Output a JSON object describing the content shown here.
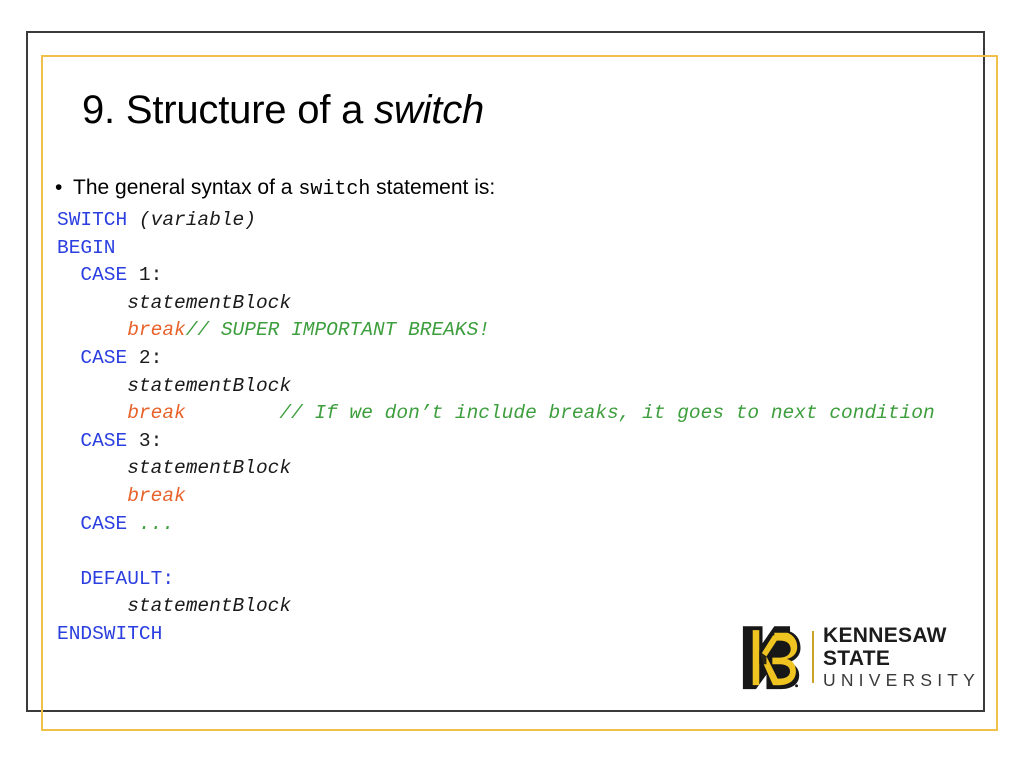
{
  "slide": {
    "title_prefix": "9. Structure of a ",
    "title_keyword": "switch",
    "bullet": {
      "marker": "•",
      "text_before": "The general syntax of a ",
      "keyword": "switch",
      "text_after": " statement is:"
    },
    "colors": {
      "keyword_blue": "#2b3fe0",
      "comment_green": "#3d9e3d",
      "break_orange": "#e8622a",
      "frame_gold": "#f0c04a",
      "frame_dark": "#3a3a3a",
      "logo_gold": "#f0c420",
      "text_black": "#1a1a1a"
    },
    "code_lines": [
      [
        {
          "t": "SWITCH",
          "c": "kw"
        },
        {
          "t": " ",
          "c": "plain"
        },
        {
          "t": "(variable)",
          "c": "var"
        }
      ],
      [
        {
          "t": "BEGIN",
          "c": "kw"
        }
      ],
      [
        {
          "t": "  ",
          "c": "plain"
        },
        {
          "t": "CASE",
          "c": "kw"
        },
        {
          "t": " 1:",
          "c": "plain"
        }
      ],
      [
        {
          "t": "      ",
          "c": "plain"
        },
        {
          "t": "statementBlock",
          "c": "var"
        }
      ],
      [
        {
          "t": "      ",
          "c": "plain"
        },
        {
          "t": "break",
          "c": "brk"
        },
        {
          "t": "// SUPER IMPORTANT BREAKS!",
          "c": "cmt"
        }
      ],
      [
        {
          "t": "  ",
          "c": "plain"
        },
        {
          "t": "CASE",
          "c": "kw"
        },
        {
          "t": " 2:",
          "c": "plain"
        }
      ],
      [
        {
          "t": "      ",
          "c": "plain"
        },
        {
          "t": "statementBlock",
          "c": "var"
        }
      ],
      [
        {
          "t": "      ",
          "c": "plain"
        },
        {
          "t": "break",
          "c": "brk"
        },
        {
          "t": "        // If we don’t include breaks, it goes to next condition",
          "c": "cmt"
        }
      ],
      [
        {
          "t": "  ",
          "c": "plain"
        },
        {
          "t": "CASE",
          "c": "kw"
        },
        {
          "t": " 3:",
          "c": "plain"
        }
      ],
      [
        {
          "t": "      ",
          "c": "plain"
        },
        {
          "t": "statementBlock",
          "c": "var"
        }
      ],
      [
        {
          "t": "      ",
          "c": "plain"
        },
        {
          "t": "break",
          "c": "brk"
        }
      ],
      [
        {
          "t": "  ",
          "c": "plain"
        },
        {
          "t": "CASE",
          "c": "kw"
        },
        {
          "t": " ",
          "c": "plain"
        },
        {
          "t": "...",
          "c": "cmt"
        }
      ],
      [
        {
          "t": " ",
          "c": "plain"
        }
      ],
      [
        {
          "t": "  ",
          "c": "plain"
        },
        {
          "t": "DEFAULT:",
          "c": "kw"
        }
      ],
      [
        {
          "t": "      ",
          "c": "plain"
        },
        {
          "t": "statementBlock",
          "c": "var"
        }
      ],
      [
        {
          "t": "ENDSWITCH",
          "c": "kw"
        }
      ]
    ],
    "logo": {
      "line1": "KENNESAW STATE",
      "line2": "UNIVERSITY"
    }
  }
}
